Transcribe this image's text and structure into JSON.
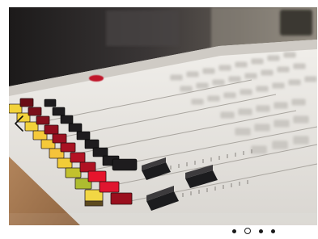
{
  "slideshow": {
    "image_subject": "mixing-console-faders",
    "current_slide": 2,
    "total_slides": 4,
    "icons": {
      "previous": "chevron-left-icon"
    },
    "colors": {
      "frame_background": "#ffffff",
      "dot_color": "#1a1a1a",
      "button_yellow": "#f2d23a",
      "button_red": "#c0132a",
      "button_green": "#9bb832",
      "fader_cap": "#1c1c1e",
      "console_panel": "#e4e1dc"
    }
  }
}
